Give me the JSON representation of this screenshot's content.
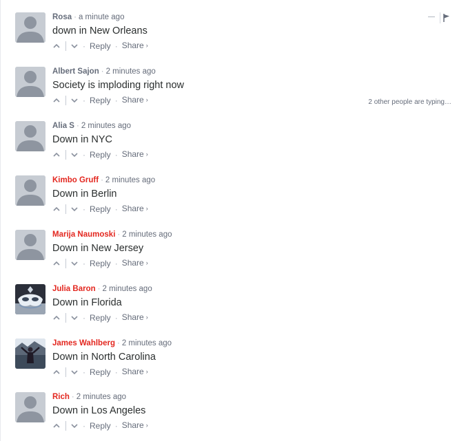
{
  "comments": [
    {
      "author": "Rosa",
      "author_color": "#656c7a",
      "time": "a minute ago",
      "text": "down in New Orleans",
      "avatar": "default-avatar"
    },
    {
      "author": "Albert Sajon",
      "author_color": "#656c7a",
      "time": "2 minutes ago",
      "text": "Society is imploding right now",
      "avatar": "default-avatar"
    },
    {
      "author": "Alia S",
      "author_color": "#656c7a",
      "time": "2 minutes ago",
      "text": "Down in NYC",
      "avatar": "default-avatar"
    },
    {
      "author": "Kimbo Gruff",
      "author_color": "#e3271f",
      "time": "2 minutes ago",
      "text": "Down in Berlin",
      "avatar": "default-avatar"
    },
    {
      "author": "Marija Naumoski",
      "author_color": "#e3271f",
      "time": "2 minutes ago",
      "text": "Down in New Jersey",
      "avatar": "default-avatar"
    },
    {
      "author": "Julia Baron",
      "author_color": "#e3271f",
      "time": "2 minutes ago",
      "text": "Down in Florida",
      "avatar": "mask-photo"
    },
    {
      "author": "James Wahlberg",
      "author_color": "#e3271f",
      "time": "2 minutes ago",
      "text": "Down in North Carolina",
      "avatar": "person-photo"
    },
    {
      "author": "Rich",
      "author_color": "#e3271f",
      "time": "2 minutes ago",
      "text": "Down in Los Angeles",
      "avatar": "default-avatar"
    }
  ],
  "actions": {
    "reply": "Reply",
    "share": "Share",
    "share_arrow": "›",
    "separator": "·"
  },
  "typing_indicator": "2 other people are typing…",
  "icons": {
    "upvote": "chevron-up-icon",
    "downvote": "chevron-down-icon",
    "collapse": "minus-icon",
    "flag": "flag-icon"
  }
}
